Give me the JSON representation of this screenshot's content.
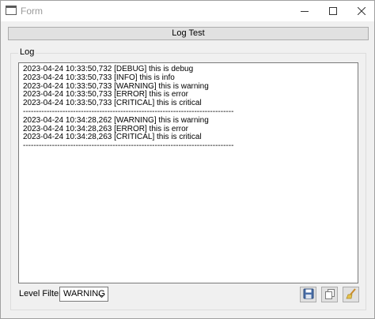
{
  "window": {
    "title": "Form"
  },
  "main_button": {
    "label": "Log Test"
  },
  "log_group": {
    "label": "Log",
    "lines": [
      "2023-04-24 10:33:50,732 [DEBUG] this is debug",
      "2023-04-24 10:33:50,733 [INFO] this is info",
      "2023-04-24 10:33:50,733 [WARNING] this is warning",
      "2023-04-24 10:33:50,733 [ERROR] this is error",
      "2023-04-24 10:33:50,733 [CRITICAL] this is critical",
      "--------------------------------------------------------------------------------",
      "2023-04-24 10:34:28,262 [WARNING] this is warning",
      "2023-04-24 10:34:28,263 [ERROR] this is error",
      "2023-04-24 10:34:28,263 [CRITICAL] this is critical",
      "--------------------------------------------------------------------------------"
    ]
  },
  "filter": {
    "label": "Level Filter",
    "value": "WARNING"
  },
  "toolbar": {
    "icons": [
      "save-icon",
      "copy-icon",
      "clear-icon"
    ]
  },
  "colors": {
    "save_icon": "#4a6fa8",
    "clear_handle": "#c98a2a",
    "clear_brush": "#e6c34a"
  }
}
